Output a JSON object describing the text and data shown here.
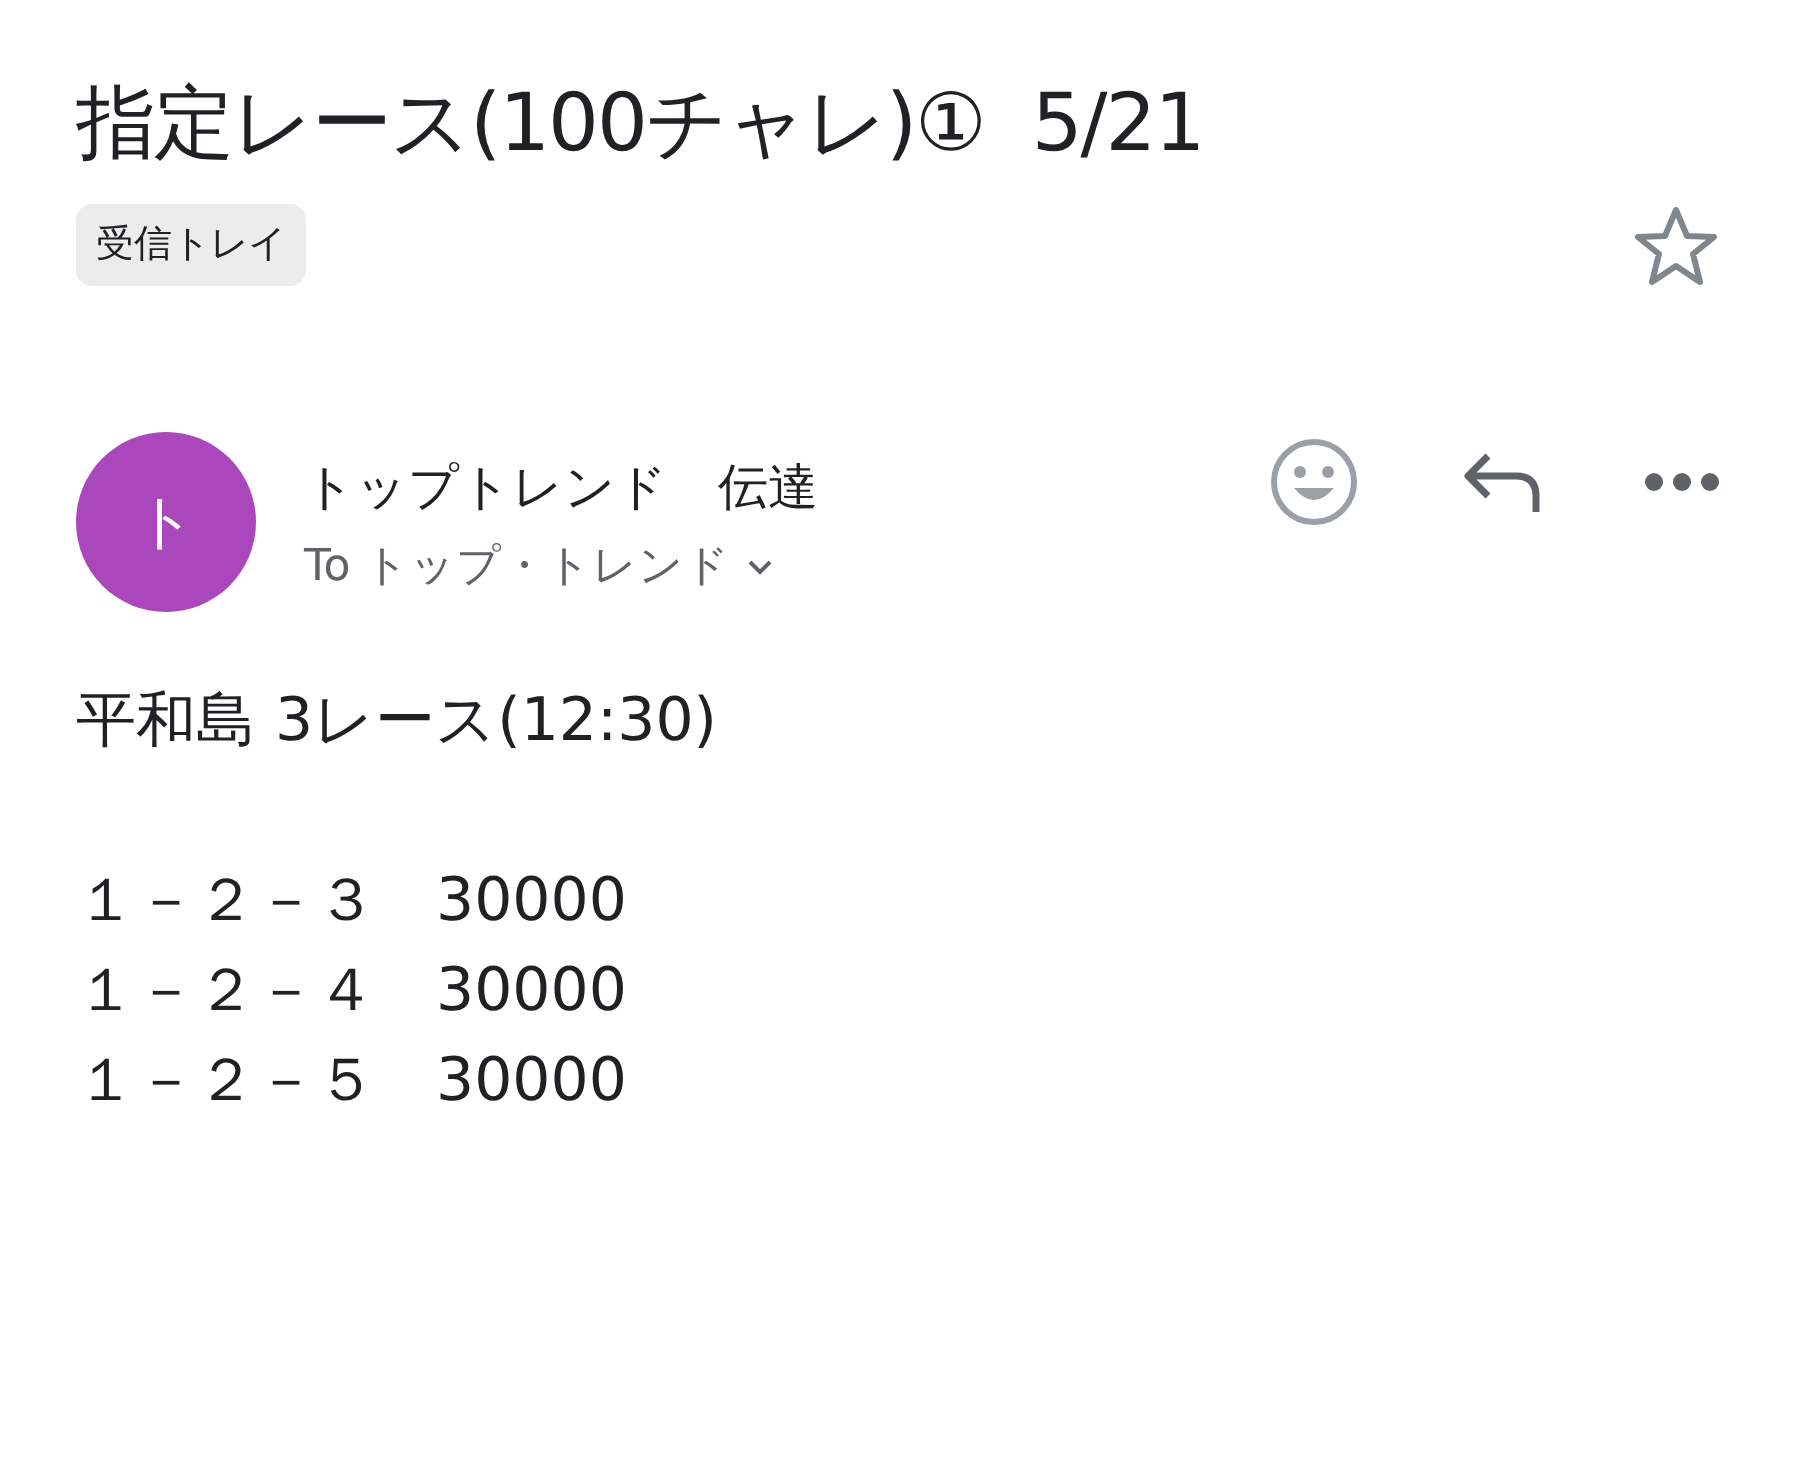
{
  "subject": "指定レース(100チャレ)①  5/21",
  "starred": false,
  "label": "受信トレイ",
  "sender": {
    "avatar": "ト",
    "name": "トップトレンド　伝達",
    "to": "To トップ・トレンド"
  },
  "body": [
    {
      "lines": [
        "平和島 3レース(12:30)"
      ]
    },
    {
      "lines": [
        "１－２－３　30000",
        "１－２－４　30000",
        "１－２－５　30000"
      ]
    }
  ]
}
